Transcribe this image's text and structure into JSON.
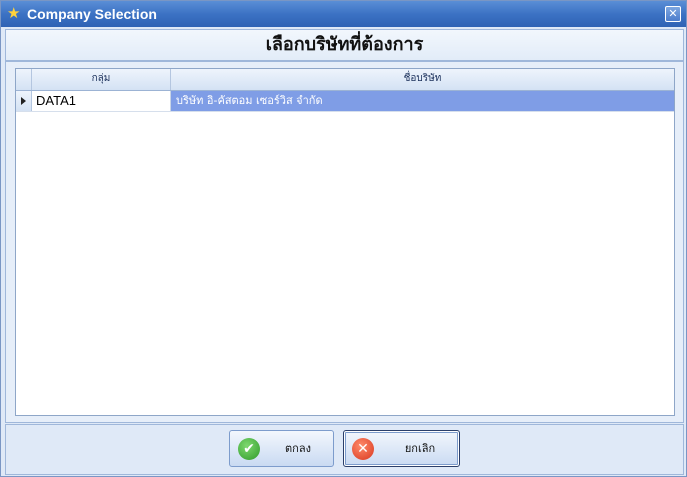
{
  "window": {
    "title": "Company Selection",
    "close_glyph": "✕",
    "title_icon": "star-icon",
    "accent_color": "#3c72c4"
  },
  "header": {
    "title": "เลือกบริษัทที่ต้องการ"
  },
  "grid": {
    "columns": [
      "กลุ่ม",
      "ชื่อบริษัท"
    ],
    "rows": [
      {
        "group": "DATA1",
        "company": "บริษัท อิ-คัสตอม เซอร์วิส จำกัด",
        "selected": true
      }
    ],
    "selected_color": "#7f9de6"
  },
  "footer": {
    "ok_label": "ตกลง",
    "cancel_label": "ยกเลิก",
    "ok_icon": "check-circle-icon",
    "cancel_icon": "x-circle-icon"
  }
}
